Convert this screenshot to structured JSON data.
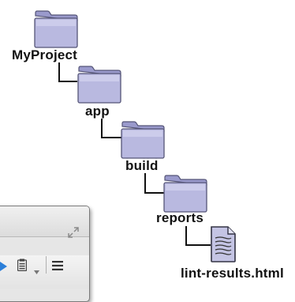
{
  "tree": {
    "nodes": [
      {
        "label": "MyProject",
        "type": "folder"
      },
      {
        "label": "app",
        "type": "folder"
      },
      {
        "label": "build",
        "type": "folder"
      },
      {
        "label": "reports",
        "type": "folder"
      },
      {
        "label": "lint-results.html",
        "type": "file"
      }
    ]
  },
  "colors": {
    "folder_light": "#c8c8e8",
    "folder_dark": "#7e7eae",
    "line": "#111111",
    "browser_frame": "#7a7a7a",
    "play_blue": "#2b7fd9"
  },
  "icons": [
    "folder-icon",
    "file-icon",
    "expand-icon",
    "play-icon",
    "clipboard-icon",
    "chevron-down-icon",
    "menu-icon"
  ]
}
